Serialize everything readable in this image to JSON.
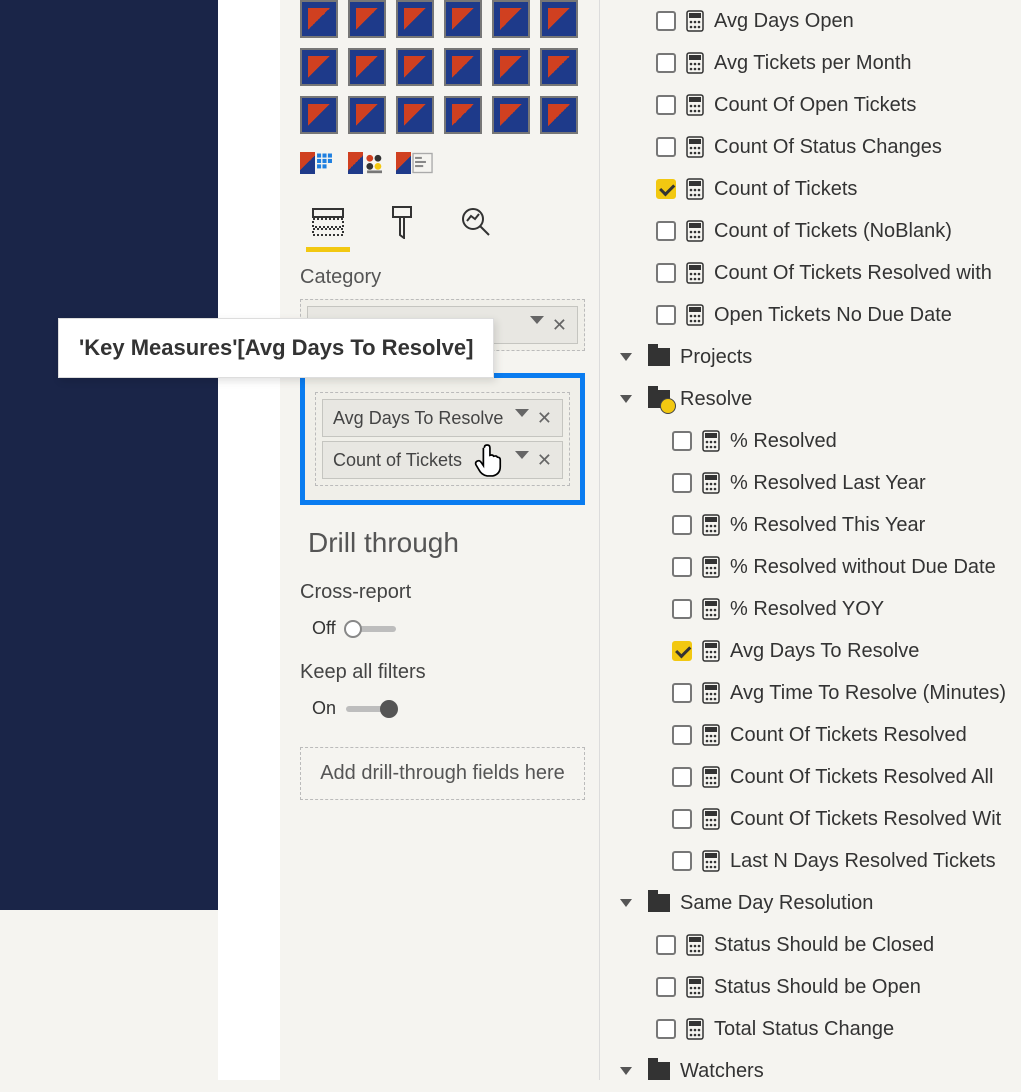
{
  "tooltip": {
    "text": "'Key Measures'[Avg Days To Resolve]"
  },
  "viz": {
    "category_label": "Category",
    "category_field": "",
    "values_field1": "Avg Days To Resolve",
    "values_field2": "Count of Tickets",
    "drill_heading": "Drill through",
    "cross_report_label": "Cross-report",
    "cross_report_state": "Off",
    "keep_filters_label": "Keep all filters",
    "keep_filters_state": "On",
    "drill_placeholder": "Add drill-through fields here"
  },
  "fields": {
    "group1": [
      {
        "label": "Avg Days Open",
        "checked": false
      },
      {
        "label": "Avg Tickets per Month",
        "checked": false
      },
      {
        "label": "Count Of Open Tickets",
        "checked": false
      },
      {
        "label": "Count Of Status Changes",
        "checked": false
      },
      {
        "label": "Count of Tickets",
        "checked": true
      },
      {
        "label": "Count of Tickets (NoBlank)",
        "checked": false
      },
      {
        "label": "Count Of Tickets Resolved with",
        "checked": false
      },
      {
        "label": "Open Tickets No Due Date",
        "checked": false
      }
    ],
    "projects_label": "Projects",
    "resolve_label": "Resolve",
    "resolve": [
      {
        "label": "% Resolved",
        "checked": false
      },
      {
        "label": "% Resolved Last Year",
        "checked": false
      },
      {
        "label": "% Resolved This Year",
        "checked": false
      },
      {
        "label": "% Resolved without Due Date",
        "checked": false
      },
      {
        "label": "% Resolved YOY",
        "checked": false
      },
      {
        "label": "Avg Days To Resolve",
        "checked": true
      },
      {
        "label": "Avg Time To Resolve (Minutes)",
        "checked": false
      },
      {
        "label": "Count Of Tickets Resolved",
        "checked": false
      },
      {
        "label": "Count Of Tickets Resolved All",
        "checked": false
      },
      {
        "label": "Count Of Tickets Resolved Wit",
        "checked": false
      },
      {
        "label": "Last N Days Resolved Tickets",
        "checked": false
      }
    ],
    "same_day_label": "Same Day Resolution",
    "same_day": [
      {
        "label": "Status Should be Closed",
        "checked": false
      },
      {
        "label": "Status Should be Open",
        "checked": false
      },
      {
        "label": "Total Status Change",
        "checked": false
      }
    ],
    "watchers_label": "Watchers"
  }
}
